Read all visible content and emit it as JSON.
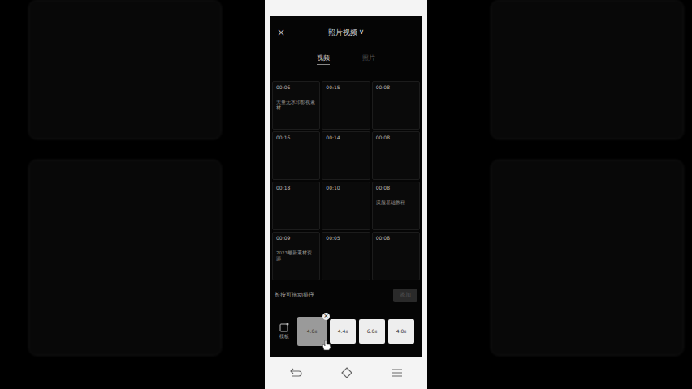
{
  "header": {
    "close": "×",
    "title": "照片视频",
    "dropdown": "∨"
  },
  "tabs": [
    {
      "label": "视频",
      "selected": true
    },
    {
      "label": "照片",
      "selected": false
    }
  ],
  "media": [
    {
      "duration": "00:06",
      "caption": "大量无水印影视素材"
    },
    {
      "duration": "00:15"
    },
    {
      "duration": "00:08"
    },
    {
      "duration": "00:16"
    },
    {
      "duration": "00:14"
    },
    {
      "duration": "00:08"
    },
    {
      "duration": "00:18"
    },
    {
      "duration": "00:10"
    },
    {
      "duration": "00:08",
      "caption": "汉服基础教程"
    },
    {
      "duration": "00:09",
      "caption": "2023最新素材资源"
    },
    {
      "duration": "00:05"
    },
    {
      "duration": "00:08"
    }
  ],
  "hint": "长按可拖动排序",
  "add_button": {
    "label": "添加",
    "enabled": false
  },
  "template": {
    "label": "模板"
  },
  "clips": [
    {
      "duration": "4.0s",
      "dragging": true,
      "remove": "×"
    },
    {
      "duration": "4.4s",
      "dragging": false
    },
    {
      "duration": "6.0s",
      "dragging": false
    },
    {
      "duration": "4.0s",
      "dragging": false
    }
  ]
}
